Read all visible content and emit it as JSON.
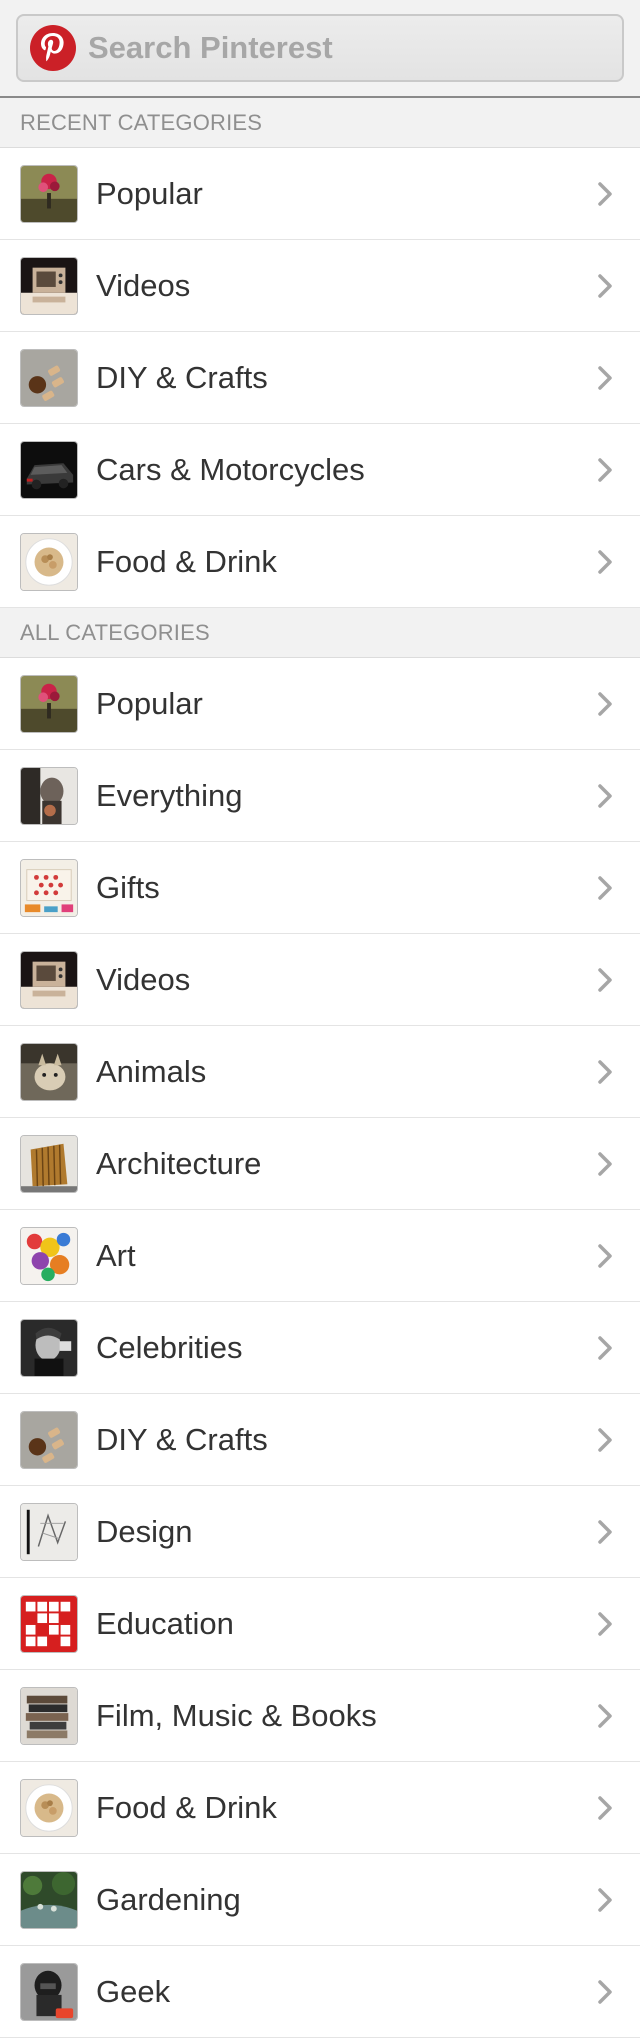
{
  "search": {
    "placeholder": "Search Pinterest",
    "logo_icon": "pinterest-logo-icon",
    "brand_color": "#cb2027"
  },
  "recent": {
    "header": "RECENT CATEGORIES",
    "items": [
      {
        "label": "Popular",
        "thumb": "popular"
      },
      {
        "label": "Videos",
        "thumb": "videos"
      },
      {
        "label": "DIY & Crafts",
        "thumb": "diy"
      },
      {
        "label": "Cars & Motorcycles",
        "thumb": "cars"
      },
      {
        "label": "Food & Drink",
        "thumb": "food"
      }
    ]
  },
  "all": {
    "header": "ALL CATEGORIES",
    "items": [
      {
        "label": "Popular",
        "thumb": "popular"
      },
      {
        "label": "Everything",
        "thumb": "everything"
      },
      {
        "label": "Gifts",
        "thumb": "gifts"
      },
      {
        "label": "Videos",
        "thumb": "videos"
      },
      {
        "label": "Animals",
        "thumb": "animals"
      },
      {
        "label": "Architecture",
        "thumb": "architecture"
      },
      {
        "label": "Art",
        "thumb": "art"
      },
      {
        "label": "Celebrities",
        "thumb": "celebrities"
      },
      {
        "label": "DIY & Crafts",
        "thumb": "diy"
      },
      {
        "label": "Design",
        "thumb": "design"
      },
      {
        "label": "Education",
        "thumb": "education"
      },
      {
        "label": "Film, Music & Books",
        "thumb": "film"
      },
      {
        "label": "Food & Drink",
        "thumb": "food"
      },
      {
        "label": "Gardening",
        "thumb": "gardening"
      },
      {
        "label": "Geek",
        "thumb": "geek"
      }
    ]
  },
  "icons": {
    "row_chevron": "chevron-right-icon"
  }
}
